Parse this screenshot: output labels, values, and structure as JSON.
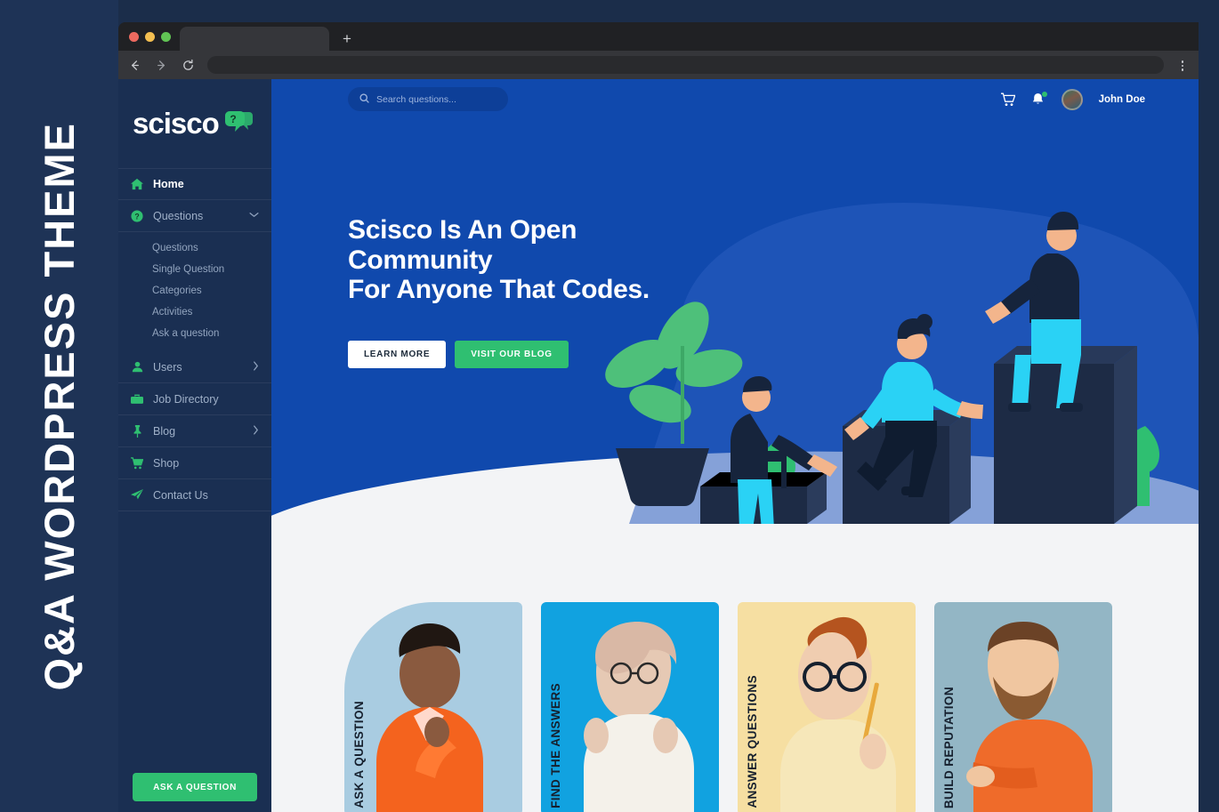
{
  "promo": {
    "text": "Q&A WORDPRESS THEME"
  },
  "browser": {
    "tab_title": "",
    "new_tab_label": "+",
    "back_icon": "arrow-left-icon",
    "forward_icon": "arrow-right-icon",
    "reload_icon": "reload-icon",
    "url_value": "",
    "url_placeholder": "",
    "menu_icon": "kebab-menu-icon"
  },
  "sidebar": {
    "logo_text": "scisco",
    "logo_mark": "question-speech-bubble-icon",
    "menu": [
      {
        "label": "Home",
        "icon": "home-icon",
        "active": true,
        "caret": ""
      },
      {
        "label": "Questions",
        "icon": "question-circle-icon",
        "active": false,
        "caret": "⌄"
      },
      {
        "label": "Users",
        "icon": "user-icon",
        "active": false,
        "caret": "›"
      },
      {
        "label": "Job Directory",
        "icon": "briefcase-icon",
        "active": false,
        "caret": ""
      },
      {
        "label": "Blog",
        "icon": "pin-icon",
        "active": false,
        "caret": "›"
      },
      {
        "label": "Shop",
        "icon": "cart-icon",
        "active": false,
        "caret": ""
      },
      {
        "label": "Contact Us",
        "icon": "paper-plane-icon",
        "active": false,
        "caret": ""
      }
    ],
    "submenu": [
      {
        "label": "Questions"
      },
      {
        "label": "Single Question"
      },
      {
        "label": "Categories"
      },
      {
        "label": "Activities"
      },
      {
        "label": "Ask a question"
      }
    ],
    "ask_button": "ASK A QUESTION"
  },
  "topbar": {
    "search_placeholder": "Search questions...",
    "search_value": "",
    "search_icon": "search-icon",
    "cart_icon": "cart-icon",
    "bell_icon": "bell-icon",
    "notification_badge": "",
    "avatar": "user-avatar",
    "username": "John Doe"
  },
  "hero": {
    "title_line1": "Scisco Is An Open Community",
    "title_line2": "For Anyone That Codes.",
    "primary_button": "LEARN MORE",
    "secondary_button": "VISIT OUR BLOG",
    "illustration": "people-climbing-steps-illustration"
  },
  "cards": [
    {
      "label": "ASK A QUESTION",
      "bg": "#a9cce1"
    },
    {
      "label": "FIND THE ANSWERS",
      "bg": "#11a2e0"
    },
    {
      "label": "ANSWER QUESTIONS",
      "bg": "#f6dfa2"
    },
    {
      "label": "BUILD REPUTATION",
      "bg": "#93b6c5"
    }
  ],
  "colors": {
    "brand_blue": "#1049ad",
    "sidebar_navy": "#1a2f52",
    "promo_navy": "#1e3356",
    "accent_green": "#2fbf71",
    "page_bg": "#f3f4f6"
  }
}
